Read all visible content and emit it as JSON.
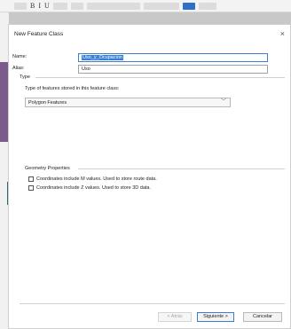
{
  "dialog": {
    "title": "New Feature Class",
    "close_glyph": "×"
  },
  "form": {
    "name_label": "Name:",
    "name_value": "Uso_y_Ocupacion",
    "alias_label": "Alias:",
    "alias_value": "Uso"
  },
  "type_section": {
    "title": "Type",
    "description": "Type of features stored in this feature class:",
    "selected_option": "Polygon Features"
  },
  "geometry": {
    "title": "Geometry Properties",
    "option_m": "Coordinates include M values. Used to store route data.",
    "option_z": "Coordinates include Z values. Used to store 3D data."
  },
  "buttons": {
    "back": "< Atrás",
    "next": "Siguiente >",
    "cancel": "Cancelar"
  },
  "colors": {
    "accent": "#3c7fd0"
  }
}
